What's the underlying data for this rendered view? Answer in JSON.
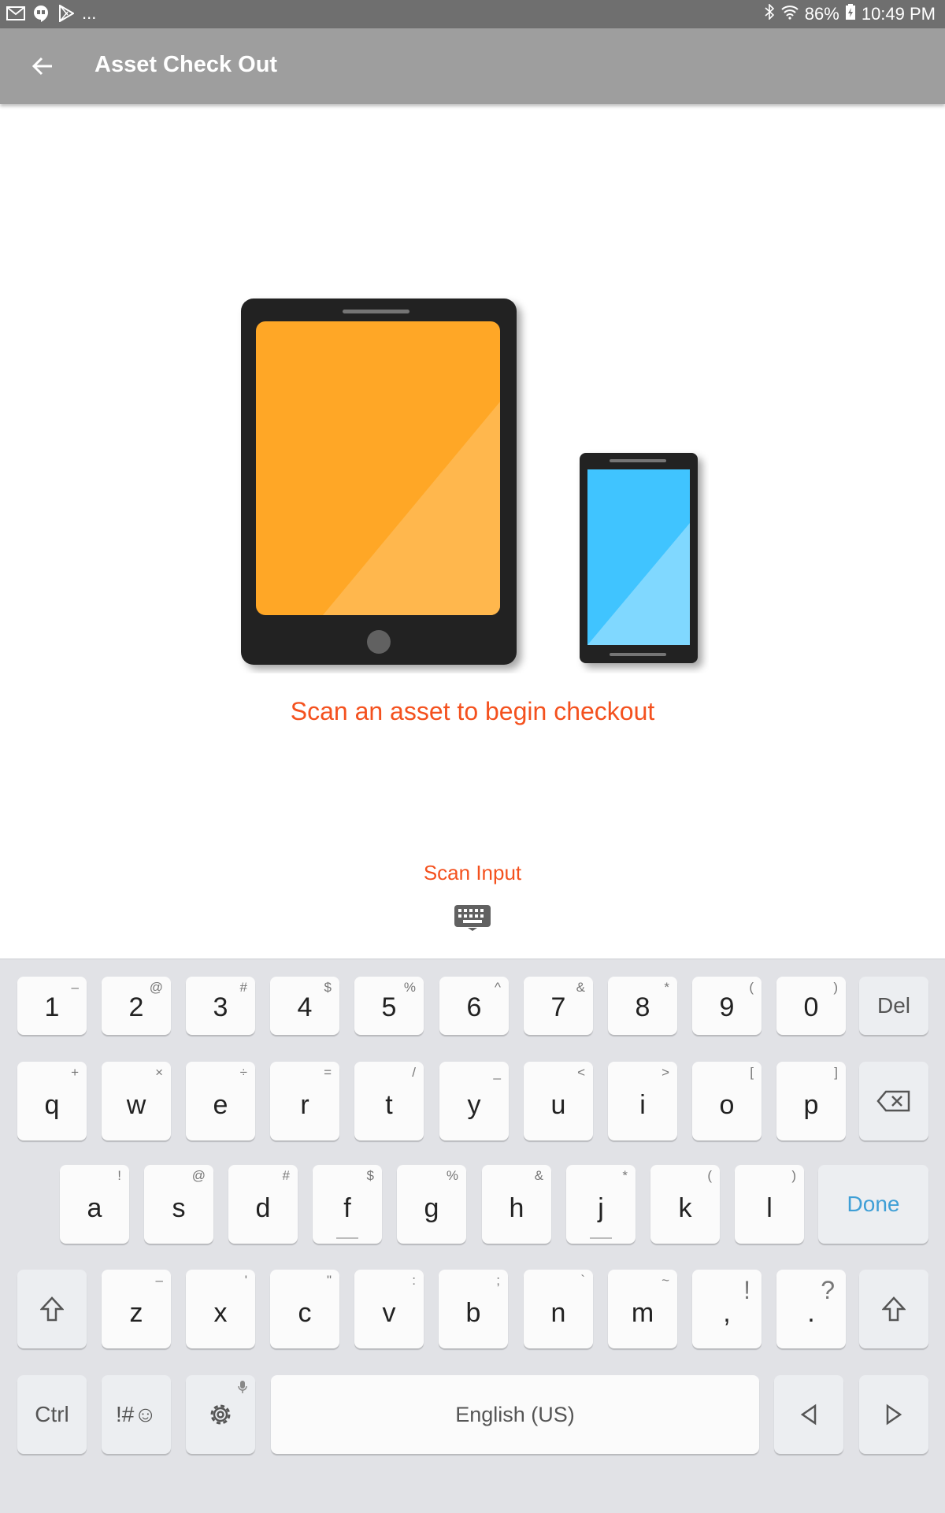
{
  "status_bar": {
    "battery": "86%",
    "time": "10:49 PM",
    "more": "..."
  },
  "toolbar": {
    "title": "Asset Check Out"
  },
  "main": {
    "message": "Scan an asset to begin checkout",
    "scan_input_label": "Scan Input"
  },
  "colors": {
    "accent": "#f4511e",
    "toolbar": "#9e9e9e",
    "tablet_screen": "#ffa726",
    "phone_screen": "#40c4ff"
  },
  "keyboard": {
    "row1": [
      [
        "1",
        "–"
      ],
      [
        "2",
        "@"
      ],
      [
        "3",
        "#"
      ],
      [
        "4",
        "$"
      ],
      [
        "5",
        "%"
      ],
      [
        "6",
        "^"
      ],
      [
        "7",
        "&"
      ],
      [
        "8",
        "*"
      ],
      [
        "9",
        "("
      ],
      [
        "0",
        ")"
      ]
    ],
    "del_label": "Del",
    "row2": [
      [
        "q",
        "+"
      ],
      [
        "w",
        "×"
      ],
      [
        "e",
        "÷"
      ],
      [
        "r",
        "="
      ],
      [
        "t",
        "/"
      ],
      [
        "y",
        "_"
      ],
      [
        "u",
        "<"
      ],
      [
        "i",
        ">"
      ],
      [
        "o",
        "["
      ],
      [
        "p",
        "]"
      ]
    ],
    "row3": [
      [
        "a",
        "!"
      ],
      [
        "s",
        "@"
      ],
      [
        "d",
        "#"
      ],
      [
        "f",
        "$"
      ],
      [
        "g",
        "%"
      ],
      [
        "h",
        "&"
      ],
      [
        "j",
        "*"
      ],
      [
        "k",
        "("
      ],
      [
        "l",
        ")"
      ]
    ],
    "done_label": "Done",
    "row4": [
      [
        "z",
        "–"
      ],
      [
        "x",
        "'"
      ],
      [
        "c",
        "\""
      ],
      [
        "v",
        ":"
      ],
      [
        "b",
        ";"
      ],
      [
        "n",
        "`"
      ],
      [
        "m",
        "~"
      ],
      [
        ",",
        "!"
      ],
      [
        ".",
        "?"
      ]
    ],
    "ctrl_label": "Ctrl",
    "symbols_label": "!#☺",
    "space_label": "English (US)"
  }
}
